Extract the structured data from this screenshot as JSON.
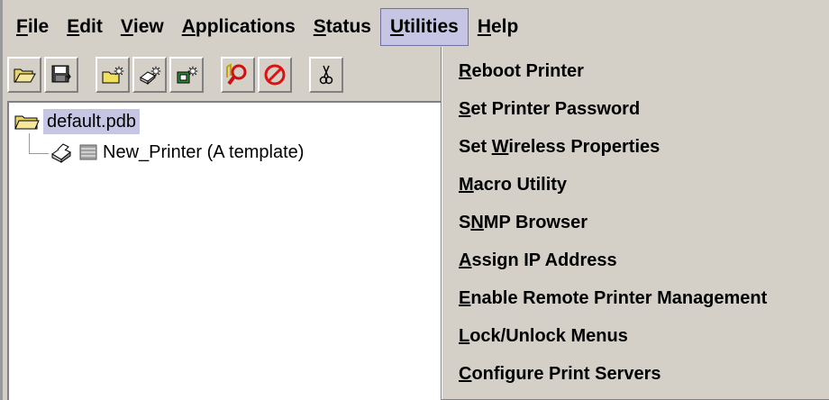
{
  "menubar": {
    "items": [
      {
        "pre": "",
        "mn": "F",
        "post": "ile"
      },
      {
        "pre": "",
        "mn": "E",
        "post": "dit"
      },
      {
        "pre": "",
        "mn": "V",
        "post": "iew"
      },
      {
        "pre": "",
        "mn": "A",
        "post": "pplications"
      },
      {
        "pre": "",
        "mn": "S",
        "post": "tatus"
      },
      {
        "pre": "",
        "mn": "U",
        "post": "tilities"
      },
      {
        "pre": "",
        "mn": "H",
        "post": "elp"
      }
    ]
  },
  "toolbar": {
    "buttons": [
      "open-folder-icon",
      "save-icon",
      "new-folder-icon",
      "new-printer-icon",
      "new-device-icon",
      "search-icon",
      "stop-icon",
      "cut-icon"
    ]
  },
  "tree": {
    "root_label": "default.pdb",
    "child_label": "New_Printer (A template)"
  },
  "utilities_menu": {
    "items": [
      {
        "pre": "",
        "mn": "R",
        "post": "eboot Printer"
      },
      {
        "pre": "",
        "mn": "S",
        "post": "et Printer Password"
      },
      {
        "pre": "Set ",
        "mn": "W",
        "post": "ireless Properties"
      },
      {
        "pre": "",
        "mn": "M",
        "post": "acro Utility"
      },
      {
        "pre": "S",
        "mn": "N",
        "post": "MP Browser"
      },
      {
        "pre": "",
        "mn": "A",
        "post": "ssign IP Address"
      },
      {
        "pre": "",
        "mn": "E",
        "post": "nable Remote Printer Management"
      },
      {
        "pre": "",
        "mn": "L",
        "post": "ock/Unlock Menus"
      },
      {
        "pre": "",
        "mn": "C",
        "post": "onfigure Print Servers"
      }
    ]
  },
  "colors": {
    "window_bg": "#d4d0c8",
    "selection_bg": "#c6c6e4",
    "tree_bg": "#ffffff"
  }
}
